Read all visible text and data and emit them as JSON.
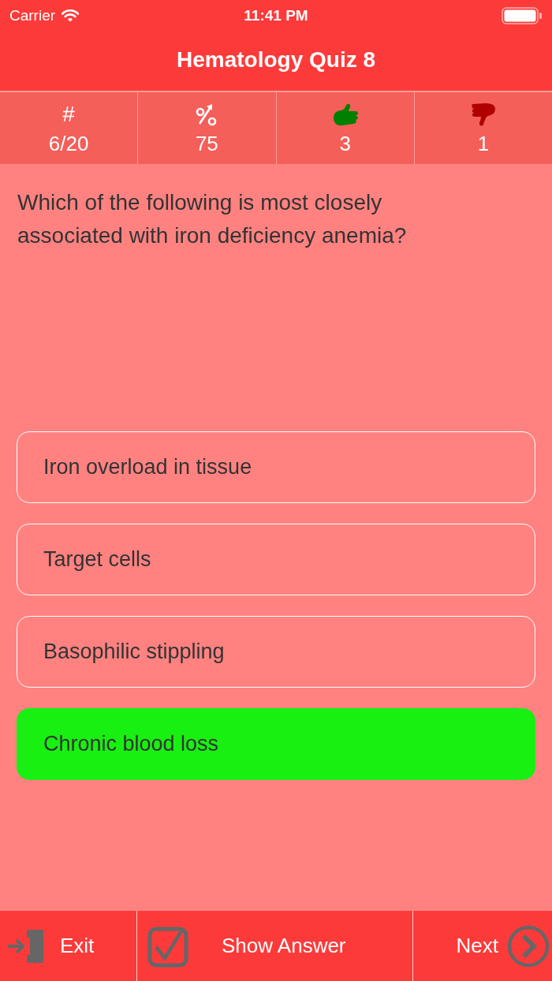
{
  "status_bar": {
    "carrier": "Carrier",
    "time": "11:41 PM"
  },
  "nav_bar": {
    "title": "Hematology Quiz 8"
  },
  "stats": [
    {
      "kind": "symbol",
      "symbol": "#",
      "value": "6/20"
    },
    {
      "kind": "percent",
      "value": "75"
    },
    {
      "kind": "thumbs_up",
      "value": "3"
    },
    {
      "kind": "thumbs_down",
      "value": "1"
    }
  ],
  "question": "Which of the following is most closely associated with iron deficiency anemia?",
  "options": [
    {
      "label": "Iron overload in tissue",
      "correct": false
    },
    {
      "label": "Target cells",
      "correct": false
    },
    {
      "label": "Basophilic stippling",
      "correct": false
    },
    {
      "label": "Chronic blood loss",
      "correct": true
    }
  ],
  "toolbar": [
    {
      "kind": "exit",
      "label": "Exit"
    },
    {
      "kind": "show_answer",
      "label": "Show Answer"
    },
    {
      "kind": "next",
      "label": "Next"
    }
  ]
}
